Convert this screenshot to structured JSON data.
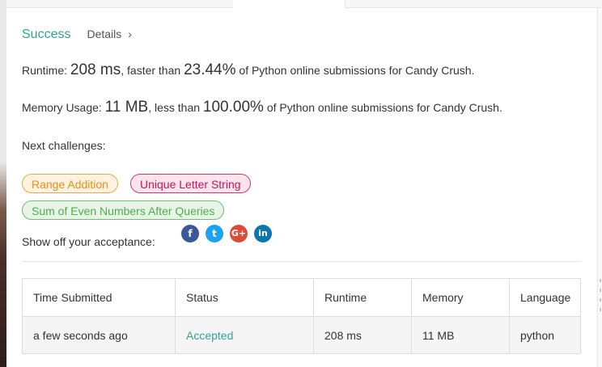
{
  "result": {
    "status": "Success",
    "details_label": "Details",
    "details_chevron": "›"
  },
  "runtime": {
    "prefix": "Runtime: ",
    "value": "208 ms",
    "mid": ", faster than ",
    "percent": "23.44%",
    "suffix": " of Python online submissions for Candy Crush."
  },
  "memory": {
    "prefix": "Memory Usage: ",
    "value": "11 MB",
    "mid": ", less than ",
    "percent": "100.00%",
    "suffix": " of Python online submissions for Candy Crush."
  },
  "next_challenges": {
    "label": "Next challenges:",
    "items": [
      {
        "label": "Range Addition",
        "color": "#e8901a"
      },
      {
        "label": "Unique Letter String",
        "color": "#c2185b"
      },
      {
        "label": "Sum of Even Numbers After Queries",
        "color": "#4caf50"
      }
    ]
  },
  "share": {
    "label": "Show off your acceptance:",
    "icons": [
      {
        "name": "facebook-icon",
        "glyph": "f"
      },
      {
        "name": "twitter-icon",
        "glyph": "t"
      },
      {
        "name": "google-plus-icon",
        "glyph": "G+"
      },
      {
        "name": "linkedin-icon",
        "glyph": "in"
      }
    ]
  },
  "table": {
    "headers": [
      "Time Submitted",
      "Status",
      "Runtime",
      "Memory",
      "Language"
    ],
    "rows": [
      [
        "a few seconds ago",
        "Accepted",
        "208 ms",
        "11 MB",
        "python"
      ]
    ]
  },
  "colors": {
    "success": "#2fa58e",
    "accepted": "#2fa58e"
  }
}
